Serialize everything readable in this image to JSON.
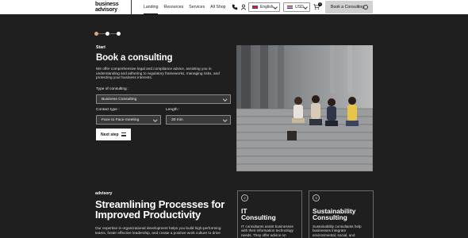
{
  "header": {
    "logo_line1": "business",
    "logo_line2": "advisory",
    "nav": [
      "Landing",
      "Resources",
      "Services",
      "All Shop"
    ],
    "language": "English",
    "currency": "USD",
    "cart_count": "0",
    "cta": "Book a Consulting"
  },
  "stepper": {
    "total_steps": 3,
    "current_step": 1
  },
  "booking": {
    "kicker": "Start",
    "title": "Book a consulting",
    "description": "We offer comprehensive legal and compliance advice, assisting you in understanding and adhering to regulatory frameworks, managing risks, and protecting your business interests.",
    "type_label": "Type of consulting :",
    "type_value": "Business Consulting",
    "contact_label": "Contact type :",
    "contact_value": "Face to Face meeting",
    "length_label": "Length :",
    "length_value": "30 min",
    "next_label": "Next step"
  },
  "advisory": {
    "kicker": "advisory",
    "title": "Streamlining Processes for Improved Productivity",
    "description": "Our expertise in organizational development helps you build high-performing teams, foster effective leadership, and create a positive work culture to drive"
  },
  "cards": [
    {
      "num": "2",
      "title_l1": "IT",
      "title_l2": "Consulting",
      "desc": "IT consultants assist businesses with their information technology needs. They offer advice on technology strategy,"
    },
    {
      "num": "3",
      "title_l1": "Sustainability",
      "title_l2": "Consulting",
      "desc": "Sustainability consultants help businesses integrate environmental, social, and governance (ESG) considerations"
    }
  ],
  "colors": {
    "accent": "#d8a77b",
    "background": "#1f1f1f",
    "cta_bg": "#d1d1d1"
  },
  "icons": [
    "phone-icon",
    "user-icon",
    "cart-icon",
    "calendar-icon",
    "list-icon",
    "chevron-down-icon"
  ]
}
